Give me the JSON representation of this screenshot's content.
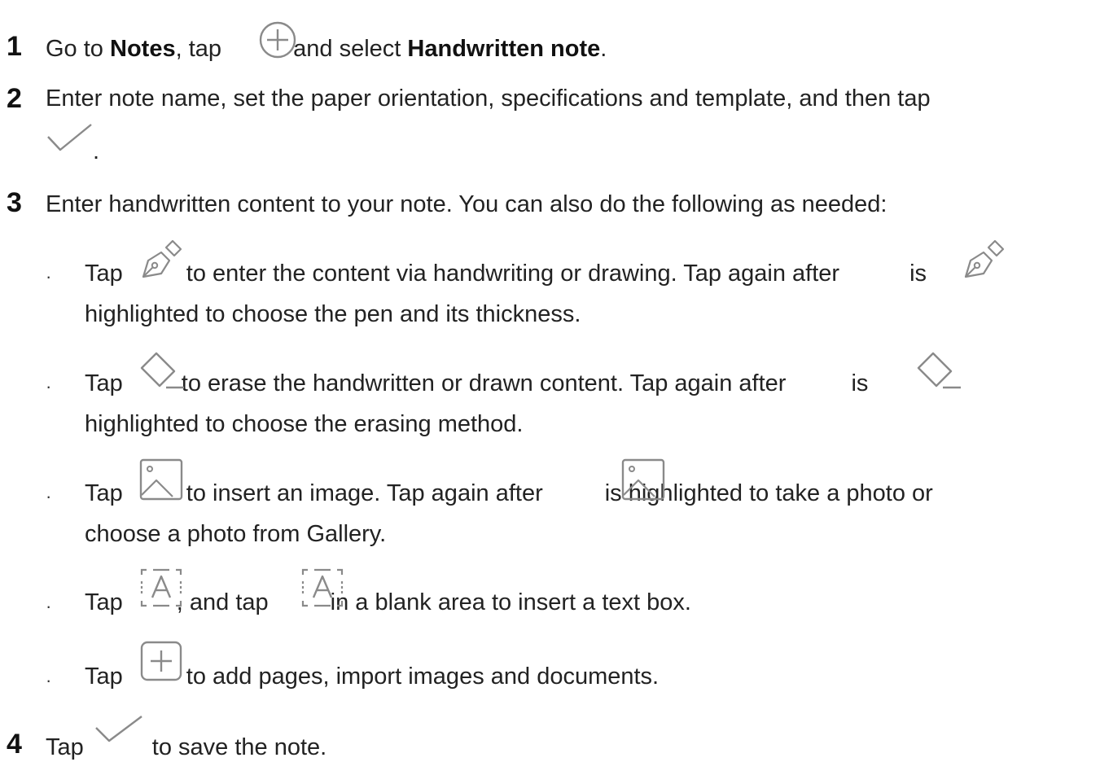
{
  "steps": [
    {
      "number": "1",
      "pre": "Go to ",
      "bold1": "Notes",
      "mid": ", tap ",
      "icon": "circle-plus-icon",
      "post": " and select ",
      "bold2": "Handwritten note",
      "end": "."
    },
    {
      "number": "2",
      "text": "Enter note name, set the paper orientation, specifications and template, and then tap",
      "icon": "checkmark-icon",
      "end": "."
    },
    {
      "number": "3",
      "text": "Enter handwritten content to your note. You can also do the following as needed:",
      "bullets": [
        {
          "marker": "·",
          "tap": "Tap",
          "icon": "pen-icon",
          "part1": "to enter the content via handwriting or drawing. Tap again after",
          "part2": "is",
          "line2": "highlighted to choose the pen and its thickness."
        },
        {
          "marker": "·",
          "tap": "Tap",
          "icon": "eraser-icon",
          "part1": "to erase the handwritten or drawn content. Tap again after",
          "part2": "is",
          "line2": "highlighted to choose the erasing method."
        },
        {
          "marker": "·",
          "tap": "Tap",
          "icon": "image-icon",
          "part1": "to insert an image. Tap again after",
          "part2": "is highlighted to take a photo or",
          "line2": "choose a photo from Gallery."
        },
        {
          "marker": "·",
          "tap": "Tap",
          "icon": "text-box-icon",
          "part1": ", and tap",
          "part2": "in a blank area to insert a text box."
        },
        {
          "marker": "·",
          "tap": "Tap",
          "icon": "add-page-icon",
          "part1": "to add pages, import images and documents."
        }
      ]
    },
    {
      "number": "4",
      "tap": "Tap",
      "icon": "checkmark-icon",
      "post": "to save the note."
    }
  ],
  "colors": {
    "text": "#222222",
    "icon": "#8a8a8a"
  }
}
